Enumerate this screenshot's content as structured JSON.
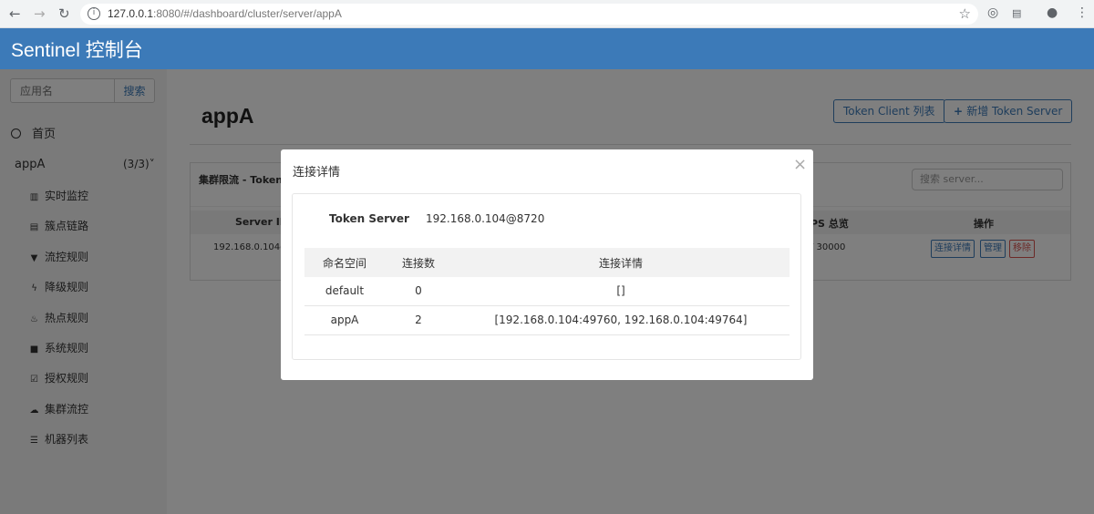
{
  "browser": {
    "url_host": "127.0.0.1",
    "url_rest": ":8080/#/dashboard/cluster/server/appA",
    "icons": [
      "back-icon",
      "forward-icon",
      "reload-icon",
      "info-icon",
      "star-icon",
      "extension-icon",
      "account-icon",
      "menu-icon"
    ]
  },
  "header": {
    "title": "Sentinel 控制台"
  },
  "sidebar": {
    "search_placeholder": "应用名",
    "search_button": "搜索",
    "home_label": "首页",
    "app_name": "appA",
    "app_count": "(3/3)",
    "items": [
      {
        "label": "实时监控",
        "icon": "bar-chart-icon"
      },
      {
        "label": "簇点链路",
        "icon": "list-icon"
      },
      {
        "label": "流控规则",
        "icon": "filter-icon"
      },
      {
        "label": "降级规则",
        "icon": "flash-icon"
      },
      {
        "label": "热点规则",
        "icon": "fire-icon"
      },
      {
        "label": "系统规则",
        "icon": "lock-icon"
      },
      {
        "label": "授权规则",
        "icon": "check-square-icon"
      },
      {
        "label": "集群流控",
        "icon": "cloud-icon"
      },
      {
        "label": "机器列表",
        "icon": "th-list-icon"
      }
    ]
  },
  "main": {
    "title": "appA",
    "token_client_button": "Token Client 列表",
    "add_server_button": "新增 Token Server",
    "panel_title": "集群限流 - Token S",
    "panel_search_placeholder": "搜索 server...",
    "columns": {
      "server_id": "Server ID",
      "qps": "PS 总览",
      "ops": "操作"
    },
    "row": {
      "server_id": "192.168.0.104@t",
      "qps": "/ 30000"
    },
    "row_buttons": {
      "detail": "连接详情",
      "manage": "管理",
      "remove": "移除"
    }
  },
  "modal": {
    "title": "连接详情",
    "close": "×",
    "token_server_label": "Token Server",
    "token_server_value": "192.168.0.104@8720",
    "table_headers": [
      "命名空间",
      "连接数",
      "连接详情"
    ],
    "table_rows": [
      {
        "namespace": "default",
        "count": "0",
        "detail": "[]"
      },
      {
        "namespace": "appA",
        "count": "2",
        "detail": "[192.168.0.104:49760, 192.168.0.104:49764]"
      }
    ]
  }
}
